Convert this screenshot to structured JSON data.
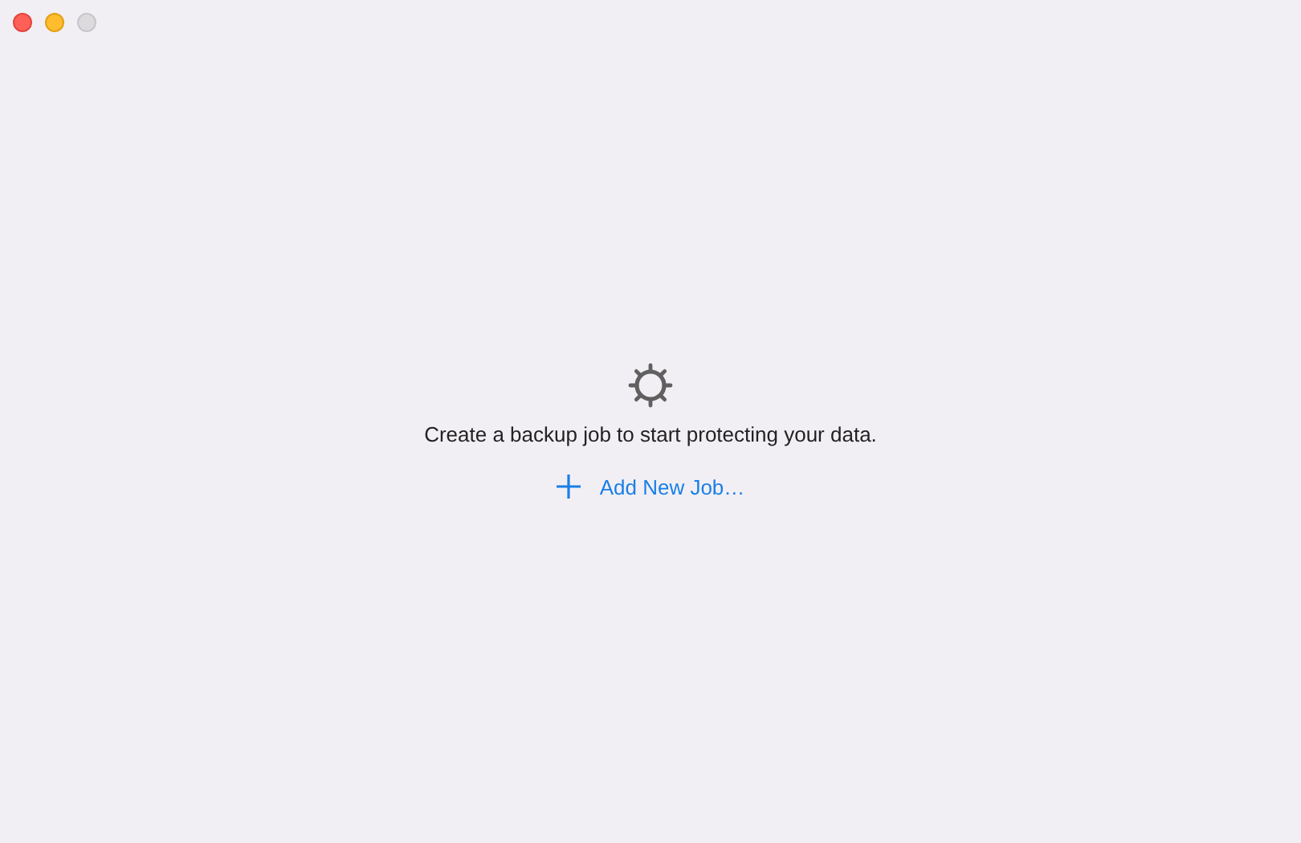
{
  "window": {
    "zoom_enabled": false
  },
  "empty_state": {
    "message": "Create a backup job to start protecting your data.",
    "action": "Add New Job…"
  }
}
